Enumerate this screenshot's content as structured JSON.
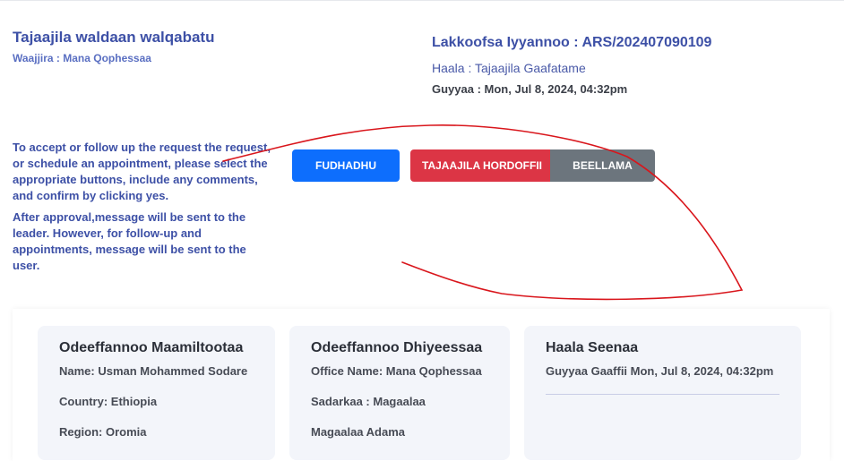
{
  "header": {
    "title": "Tajaajila waldaan walqabatu",
    "subtitle": "Waajjira : Mana Qophessaa"
  },
  "request": {
    "reference": "Lakkoofsa Iyyannoo : ARS/202407090109",
    "status": "Haala : Tajaajila Gaafatame",
    "date": "Guyyaa : Mon, Jul 8, 2024, 04:32pm"
  },
  "instructions": {
    "paragraph1": "To accept or follow up the request the request, or schedule an appointment, please select the appropriate buttons, include any comments, and confirm by clicking yes.",
    "paragraph2": "After approval,message will be sent to the leader. However, for follow-up and appointments, message will be sent to the user."
  },
  "actions": {
    "accept_label": "FUDHADHU",
    "follow_up_label": "TAJAAJILA HORDOFFII",
    "appointment_label": "BEELLAMA"
  },
  "colors": {
    "accent": "#3d50a6",
    "accept": "#0d6efd",
    "follow_up": "#dc3545",
    "appointment": "#6c757d",
    "annotation_stroke": "#d9161c"
  },
  "cards": {
    "customer": {
      "heading": "Odeeffannoo Maamiltootaa",
      "name": "Name: Usman Mohammed Sodare",
      "country": "Country: Ethiopia",
      "region": "Region: Oromia"
    },
    "office": {
      "heading": "Odeeffannoo Dhiyeessaa",
      "office_name": "Office Name: Mana Qophessaa",
      "sector": "Sadarkaa : Magaalaa",
      "city": "Magaalaa Adama"
    },
    "history": {
      "heading": "Haala Seenaa",
      "requested": "Guyyaa Gaaffii Mon, Jul 8, 2024, 04:32pm"
    }
  }
}
